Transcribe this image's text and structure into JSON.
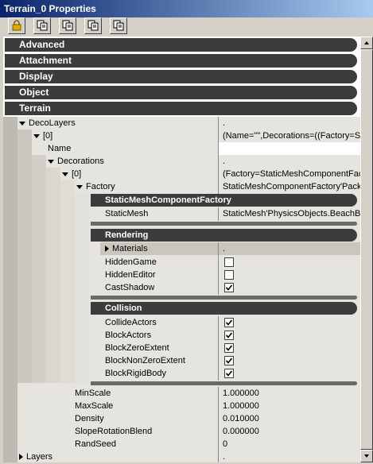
{
  "window": {
    "title": "Terrain_0 Properties"
  },
  "toolbar": {
    "buttons": [
      "lock-icon",
      "copy-icon",
      "copy-icon",
      "copy-icon",
      "copy-icon"
    ]
  },
  "categories": [
    "Advanced",
    "Attachment",
    "Display",
    "Object",
    "Terrain"
  ],
  "rows": {
    "decolayers": {
      "label": "DecoLayers",
      "value": "."
    },
    "index0": {
      "label": "[0]",
      "value": "(Name=\"\",Decorations=((Factory=Sta"
    },
    "name": {
      "label": "Name",
      "value": ""
    },
    "decorations": {
      "label": "Decorations",
      "value": "."
    },
    "dec_index0": {
      "label": "[0]",
      "value": "(Factory=StaticMeshComponentFact"
    },
    "factory": {
      "label": "Factory",
      "value": "StaticMeshComponentFactory'Pack"
    },
    "smcf_header": "StaticMeshComponentFactory",
    "staticmesh": {
      "label": "StaticMesh",
      "value": "StaticMesh'PhysicsObjects.BeachB"
    },
    "rendering_header": "Rendering",
    "materials": {
      "label": "Materials",
      "value": "."
    },
    "hiddengame": {
      "label": "HiddenGame",
      "checked": false
    },
    "hiddeneditor": {
      "label": "HiddenEditor",
      "checked": false
    },
    "castshadow": {
      "label": "CastShadow",
      "checked": true
    },
    "collision_header": "Collision",
    "collideactors": {
      "label": "CollideActors",
      "checked": true
    },
    "blockactors": {
      "label": "BlockActors",
      "checked": true
    },
    "blockzeroextent": {
      "label": "BlockZeroExtent",
      "checked": true
    },
    "blocknonzeroextent": {
      "label": "BlockNonZeroExtent",
      "checked": true
    },
    "blockrigidbody": {
      "label": "BlockRigidBody",
      "checked": true
    },
    "minscale": {
      "label": "MinScale",
      "value": "1.000000"
    },
    "maxscale": {
      "label": "MaxScale",
      "value": "1.000000"
    },
    "density": {
      "label": "Density",
      "value": "0.010000"
    },
    "sloperotationblend": {
      "label": "SlopeRotationBlend",
      "value": "0.000000"
    },
    "randseed": {
      "label": "RandSeed",
      "value": "0"
    },
    "layers": {
      "label": "Layers",
      "value": "."
    }
  }
}
